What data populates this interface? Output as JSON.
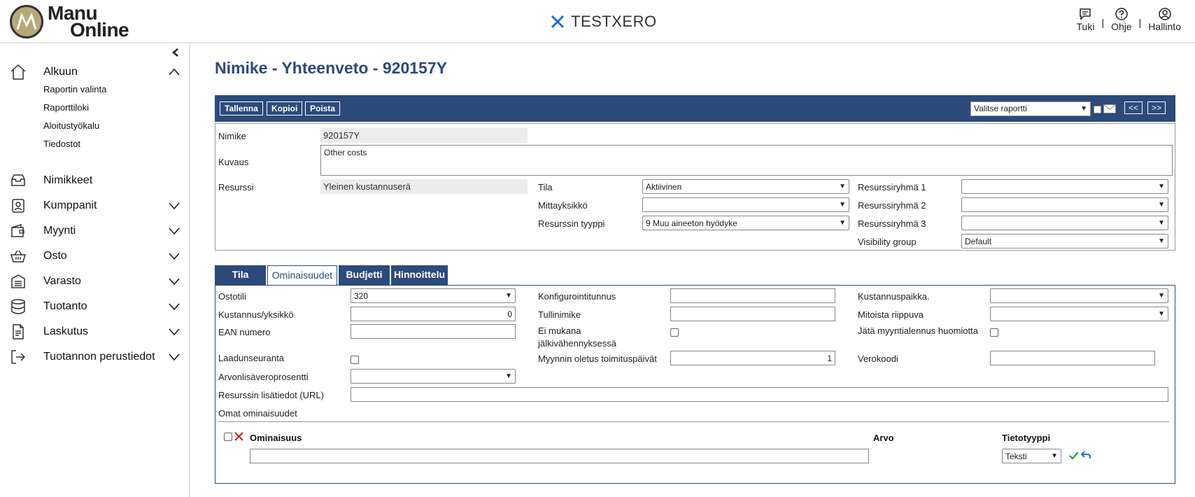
{
  "header": {
    "logo_line1": "Manu",
    "logo_line2": "Online",
    "company": "TESTXERO",
    "actions": [
      {
        "label": "Tuki",
        "icon": "chat-icon"
      },
      {
        "label": "Ohje",
        "icon": "help-icon"
      },
      {
        "label": "Hallinto",
        "icon": "user-icon"
      }
    ],
    "separator": "|"
  },
  "sidebar": {
    "collapse_icon": "chevron-left-icon",
    "items": [
      {
        "label": "Alkuun",
        "icon": "home-icon",
        "expanded": true
      },
      {
        "label": "Nimikkeet",
        "icon": "inbox-icon"
      },
      {
        "label": "Kumppanit",
        "icon": "contacts-icon"
      },
      {
        "label": "Myynti",
        "icon": "wallet-icon"
      },
      {
        "label": "Osto",
        "icon": "basket-icon"
      },
      {
        "label": "Varasto",
        "icon": "warehouse-icon"
      },
      {
        "label": "Tuotanto",
        "icon": "database-icon"
      },
      {
        "label": "Laskutus",
        "icon": "document-icon"
      },
      {
        "label": "Tuotannon perustiedot",
        "icon": "exit-icon"
      }
    ],
    "sub_items": [
      "Raportin valinta",
      "Raporttiloki",
      "Aloitustyökalu",
      "Tiedostot"
    ]
  },
  "page": {
    "title": "Nimike - Yhteenveto - 920157Y"
  },
  "toolbar": {
    "buttons": [
      "Tallenna",
      "Kopioi",
      "Poista"
    ],
    "report_select": "Valitse raportti",
    "prev": "<<",
    "next": ">>"
  },
  "summary": {
    "nimike_label": "Nimike",
    "nimike_value": "920157Y",
    "kuvaus_label": "Kuvaus",
    "kuvaus_value": "Other costs",
    "resurssi_label": "Resurssi",
    "resurssi_value": "Yleinen kustannuserä",
    "tila_label": "Tila",
    "tila_value": "Aktiivinen",
    "mittayksikko_label": "Mittayksikkö",
    "mittayksikko_value": "",
    "tyyppi_label": "Resurssin tyyppi",
    "tyyppi_value": "9 Muu aineeton hyödyke",
    "rg1_label": "Resurssiryhmä 1",
    "rg2_label": "Resurssiryhmä 2",
    "rg3_label": "Resurssiryhmä 3",
    "visibility_label": "Visibility group",
    "visibility_value": "Default"
  },
  "tabs": [
    "Tila",
    "Ominaisuudet",
    "Budjetti",
    "Hinnoittelu"
  ],
  "active_tab": "Ominaisuudet",
  "properties": {
    "ostotili_label": "Ostotili",
    "ostotili_value": "320",
    "kustannus_label": "Kustannus/yksikkö",
    "kustannus_value": "0",
    "ean_label": "EAN numero",
    "laadun_label": "Laadunseuranta",
    "alv_label": "Arvonlisäveroprosentti",
    "url_label": "Resurssin lisätiedot (URL)",
    "omat_label": "Omat ominaisuudet",
    "konf_label": "Konfigurointitunnus",
    "tulli_label": "Tullinimike",
    "ei_mukana_label_1": "Ei mukana",
    "ei_mukana_label_2": "jälkivähennyksessä",
    "toimitus_label": "Myynnin oletus toimituspäivät",
    "toimitus_value": "1",
    "kustpaikka_label": "Kustannuspaikka.",
    "mitoista_label": "Mitoista riippuva",
    "jata_label": "Jätä myyntialennus huomiotta",
    "verokoodi_label": "Verokoodi"
  },
  "custom_table": {
    "headers": [
      "Ominaisuus",
      "Arvo",
      "Tietotyyppi"
    ],
    "datatype_value": "Teksti"
  },
  "colors": {
    "primary": "#2c4a7a",
    "confirm": "#2a9d2a",
    "delete": "#cc2222"
  }
}
